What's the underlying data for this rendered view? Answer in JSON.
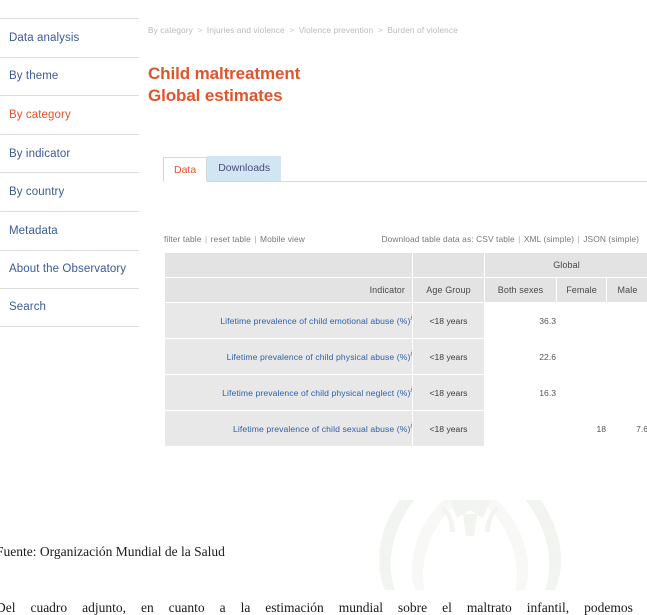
{
  "sidebar": {
    "items": [
      {
        "label": "Data analysis",
        "active": false
      },
      {
        "label": "By theme",
        "active": false
      },
      {
        "label": "By category",
        "active": true
      },
      {
        "label": "By indicator",
        "active": false
      },
      {
        "label": "By country",
        "active": false
      },
      {
        "label": "Metadata",
        "active": false
      },
      {
        "label": "About the Observatory",
        "active": false
      },
      {
        "label": "Search",
        "active": false
      }
    ]
  },
  "breadcrumb": {
    "separator": ">",
    "items": [
      "By category",
      "Injuries and violence",
      "Violence prevention",
      "Burden of violence"
    ]
  },
  "header": {
    "title_line1": "Child maltreatment",
    "title_line2": "Global estimates",
    "title_color": "#e0552a"
  },
  "tabs": [
    {
      "label": "Data",
      "active": true
    },
    {
      "label": "Downloads",
      "active": false
    }
  ],
  "table_tools": {
    "filter": "filter table",
    "reset": "reset table",
    "mobile": "Mobile view",
    "separator": "|"
  },
  "download_tools": {
    "prefix": "Download table data as:",
    "csv": "CSV table",
    "xml": "XML (simple)",
    "json": "JSON (simple)",
    "separator": "|"
  },
  "table": {
    "group_header": "Global",
    "columns": [
      "Indicator",
      "Age Group",
      "Both sexes",
      "Female",
      "Male"
    ],
    "rows": [
      {
        "indicator": "Lifetime prevalence of child emotional abuse (%)",
        "info_marker": "i",
        "age_group": "<18 years",
        "both_sexes": "36.3",
        "female": "",
        "male": ""
      },
      {
        "indicator": "Lifetime prevalence of child physical abuse (%)",
        "info_marker": "i",
        "age_group": "<18 years",
        "both_sexes": "22.6",
        "female": "",
        "male": ""
      },
      {
        "indicator": "Lifetime prevalence of child physical neglect (%)",
        "info_marker": "i",
        "age_group": "<18 years",
        "both_sexes": "16.3",
        "female": "",
        "male": ""
      },
      {
        "indicator": "Lifetime prevalence of child sexual abuse (%)",
        "info_marker": "i",
        "age_group": "<18 years",
        "both_sexes": "",
        "female": "18",
        "male": "7.6"
      }
    ]
  },
  "document": {
    "source": "Fuente: Organización Mundial de la Salud",
    "paragraph": "Del cuadro adjunto, en cuanto a la estimación mundial sobre el maltrato infantil, podemos"
  }
}
